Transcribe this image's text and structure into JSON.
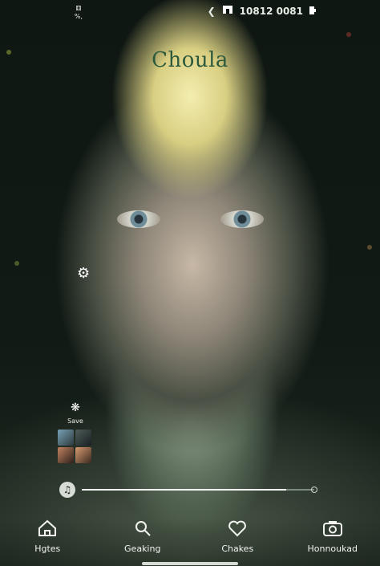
{
  "status_bar": {
    "left_top": "⚅",
    "left_bottom": "%,",
    "right_text": "10812 0081"
  },
  "app": {
    "title": "Choula"
  },
  "side_actions": {
    "settings_icon": "settings-icon",
    "save_label": "Save"
  },
  "playback": {
    "progress": 0.88
  },
  "nav": [
    {
      "label": "Hgtes",
      "icon": "home-icon"
    },
    {
      "label": "Geaking",
      "icon": "search-icon"
    },
    {
      "label": "Chakes",
      "icon": "heart-icon"
    },
    {
      "label": "Honnoukad",
      "icon": "camera-icon"
    }
  ],
  "colors": {
    "title": "#2d5a3c",
    "accent": "#f2f5f1"
  }
}
